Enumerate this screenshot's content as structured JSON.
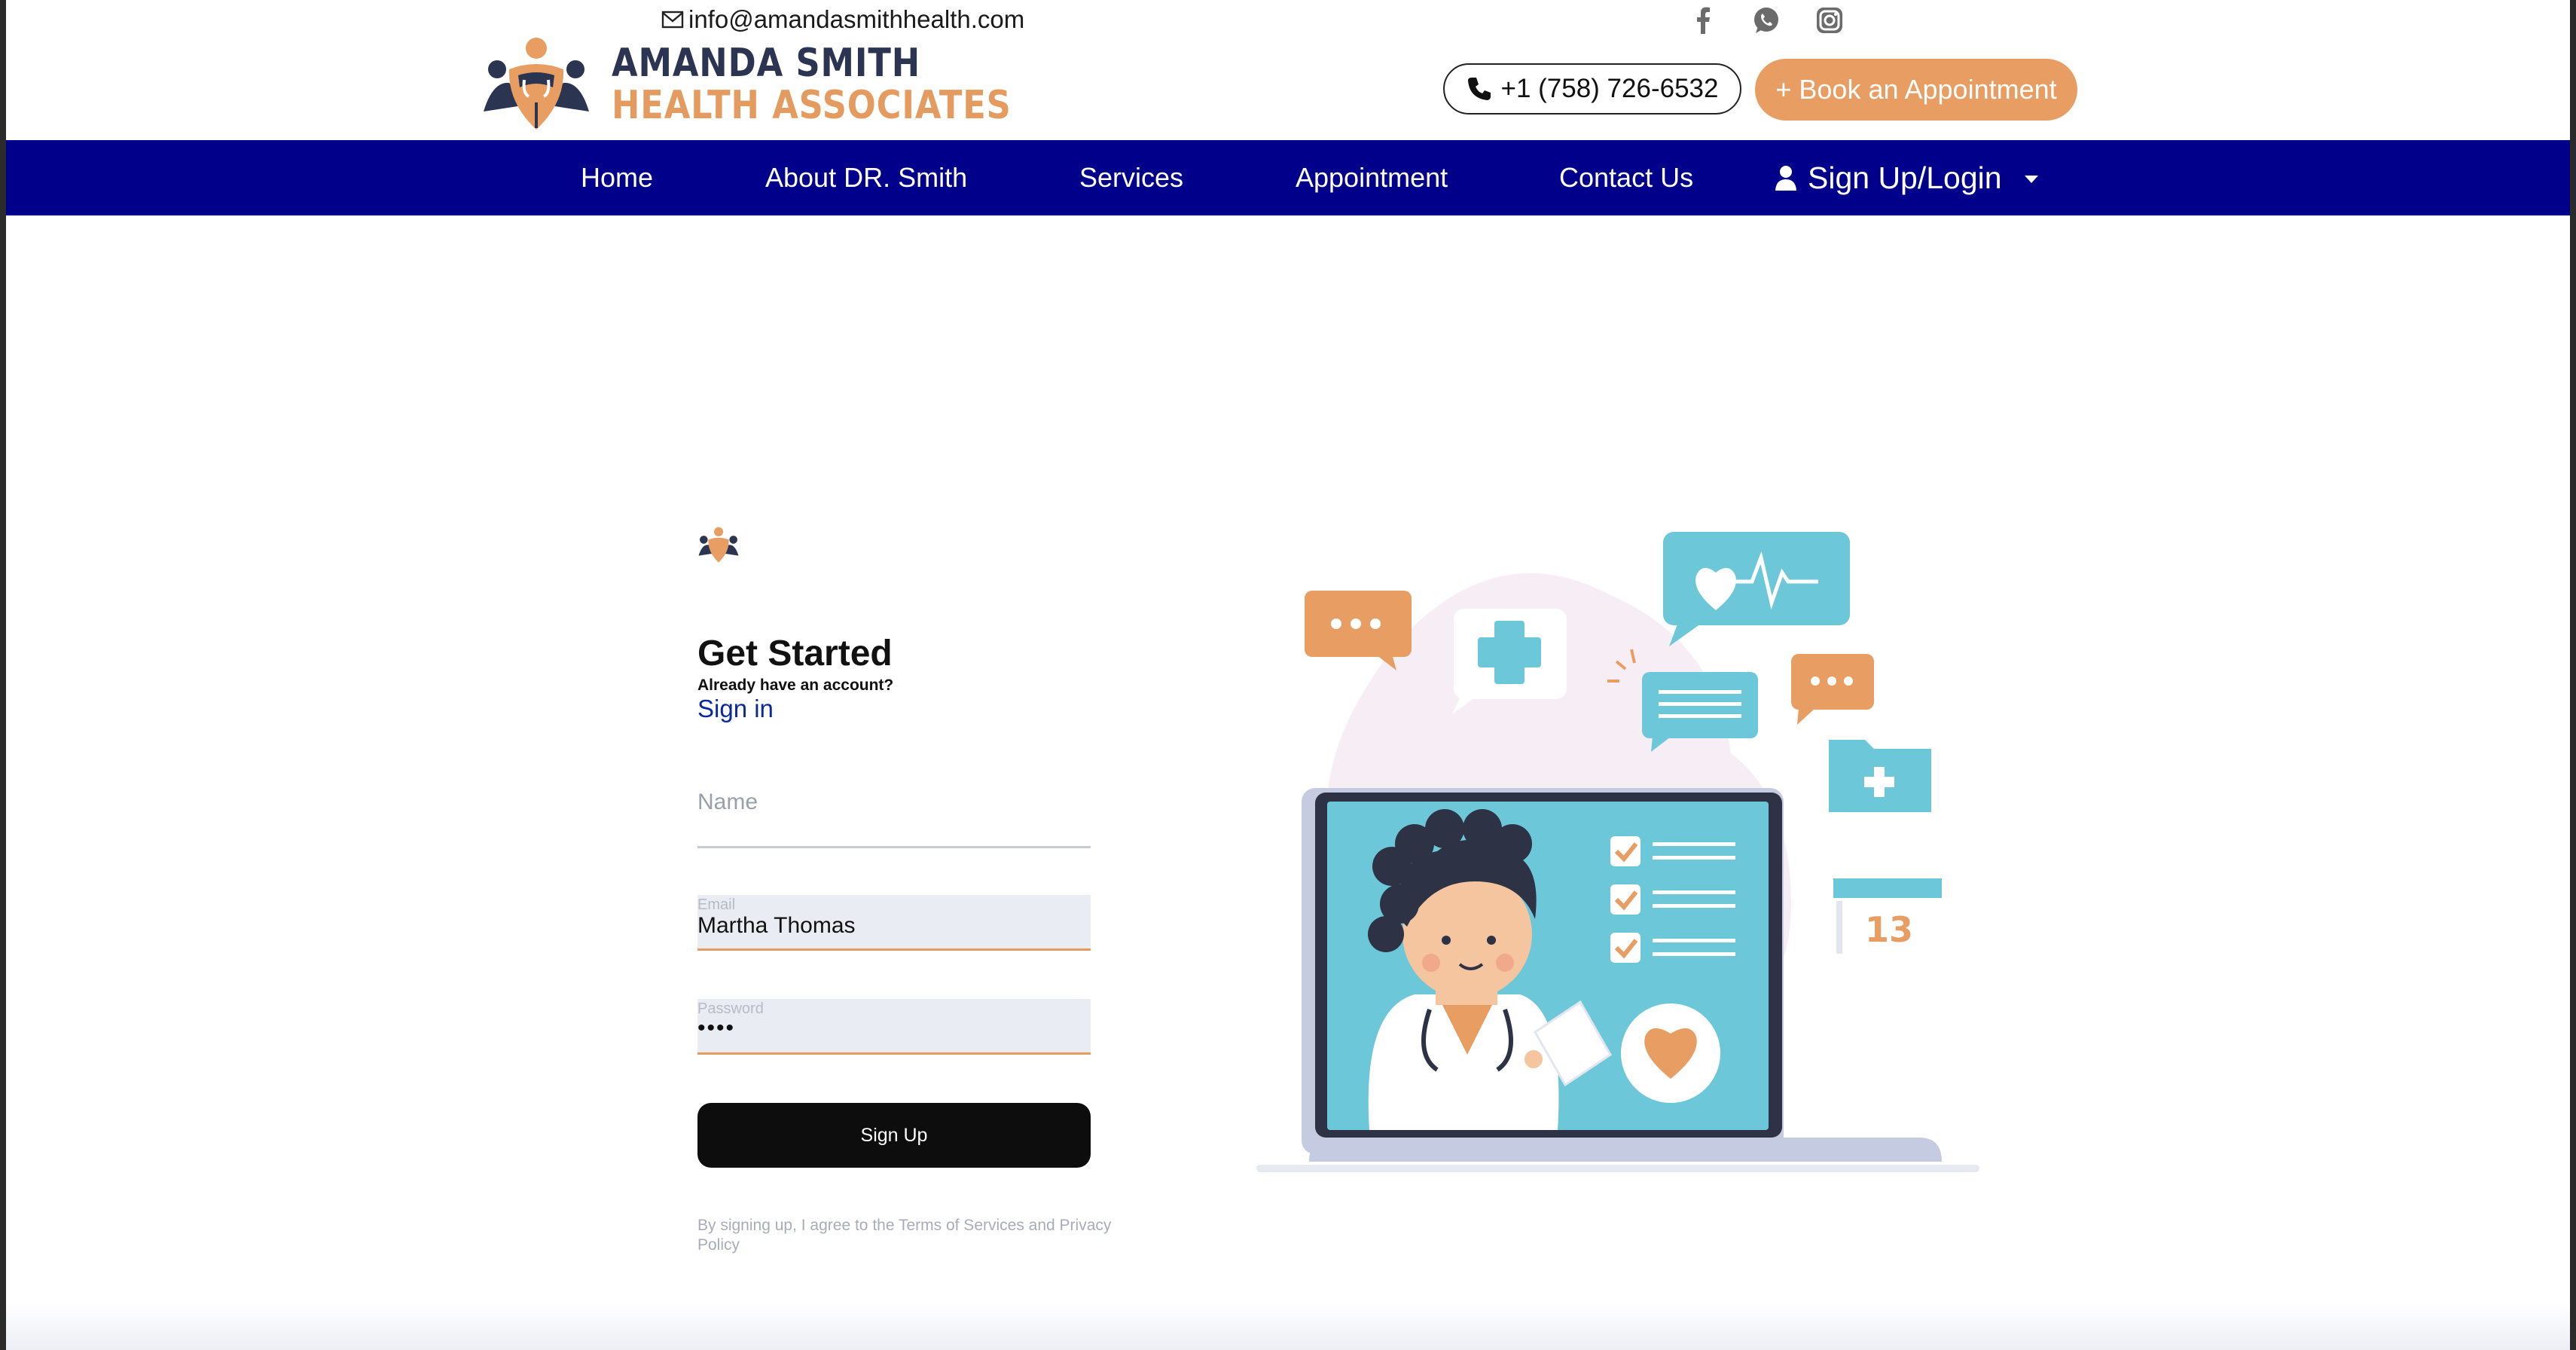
{
  "header": {
    "email": "info@amandasmithhealth.com",
    "logo_line1": "AMANDA SMITH",
    "logo_line2": "HEALTH ASSOCIATES",
    "phone": "+1 (758) 726-6532",
    "book_button": "+ Book an Appointment",
    "social": [
      "facebook-icon",
      "whatsapp-icon",
      "instagram-icon"
    ]
  },
  "nav": {
    "items": [
      "Home",
      "About DR. Smith",
      "Services",
      "Appointment",
      "Contact Us"
    ],
    "login": "Sign Up/Login"
  },
  "form": {
    "title": "Get Started",
    "already": "Already have an account?",
    "signin": "Sign in",
    "name_placeholder": "Name",
    "email_label": "Email",
    "email_value": "Martha Thomas",
    "password_label": "Password",
    "password_value": "••••",
    "submit": "Sign Up",
    "terms": "By signing up, I agree to the Terms of Services and Privacy Policy"
  },
  "illustration": {
    "calendar_day": "13"
  },
  "colors": {
    "nav_bg": "#00008b",
    "accent_orange": "#e89e63",
    "brand_navy": "#2b3450",
    "teal": "#6cc7d8"
  }
}
